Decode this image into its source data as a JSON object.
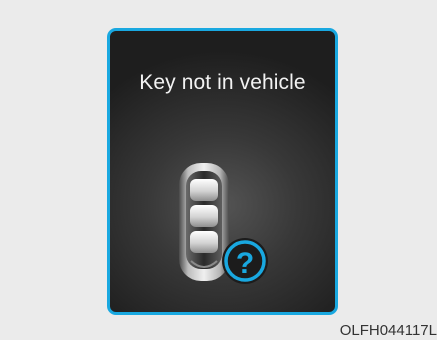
{
  "cluster_display": {
    "message": "Key not in vehicle",
    "border_color": "#19a8e0",
    "icon": "smart-key-fob-icon",
    "status_icon": "question-mark-icon"
  },
  "figure_code": "OLFH044117L"
}
